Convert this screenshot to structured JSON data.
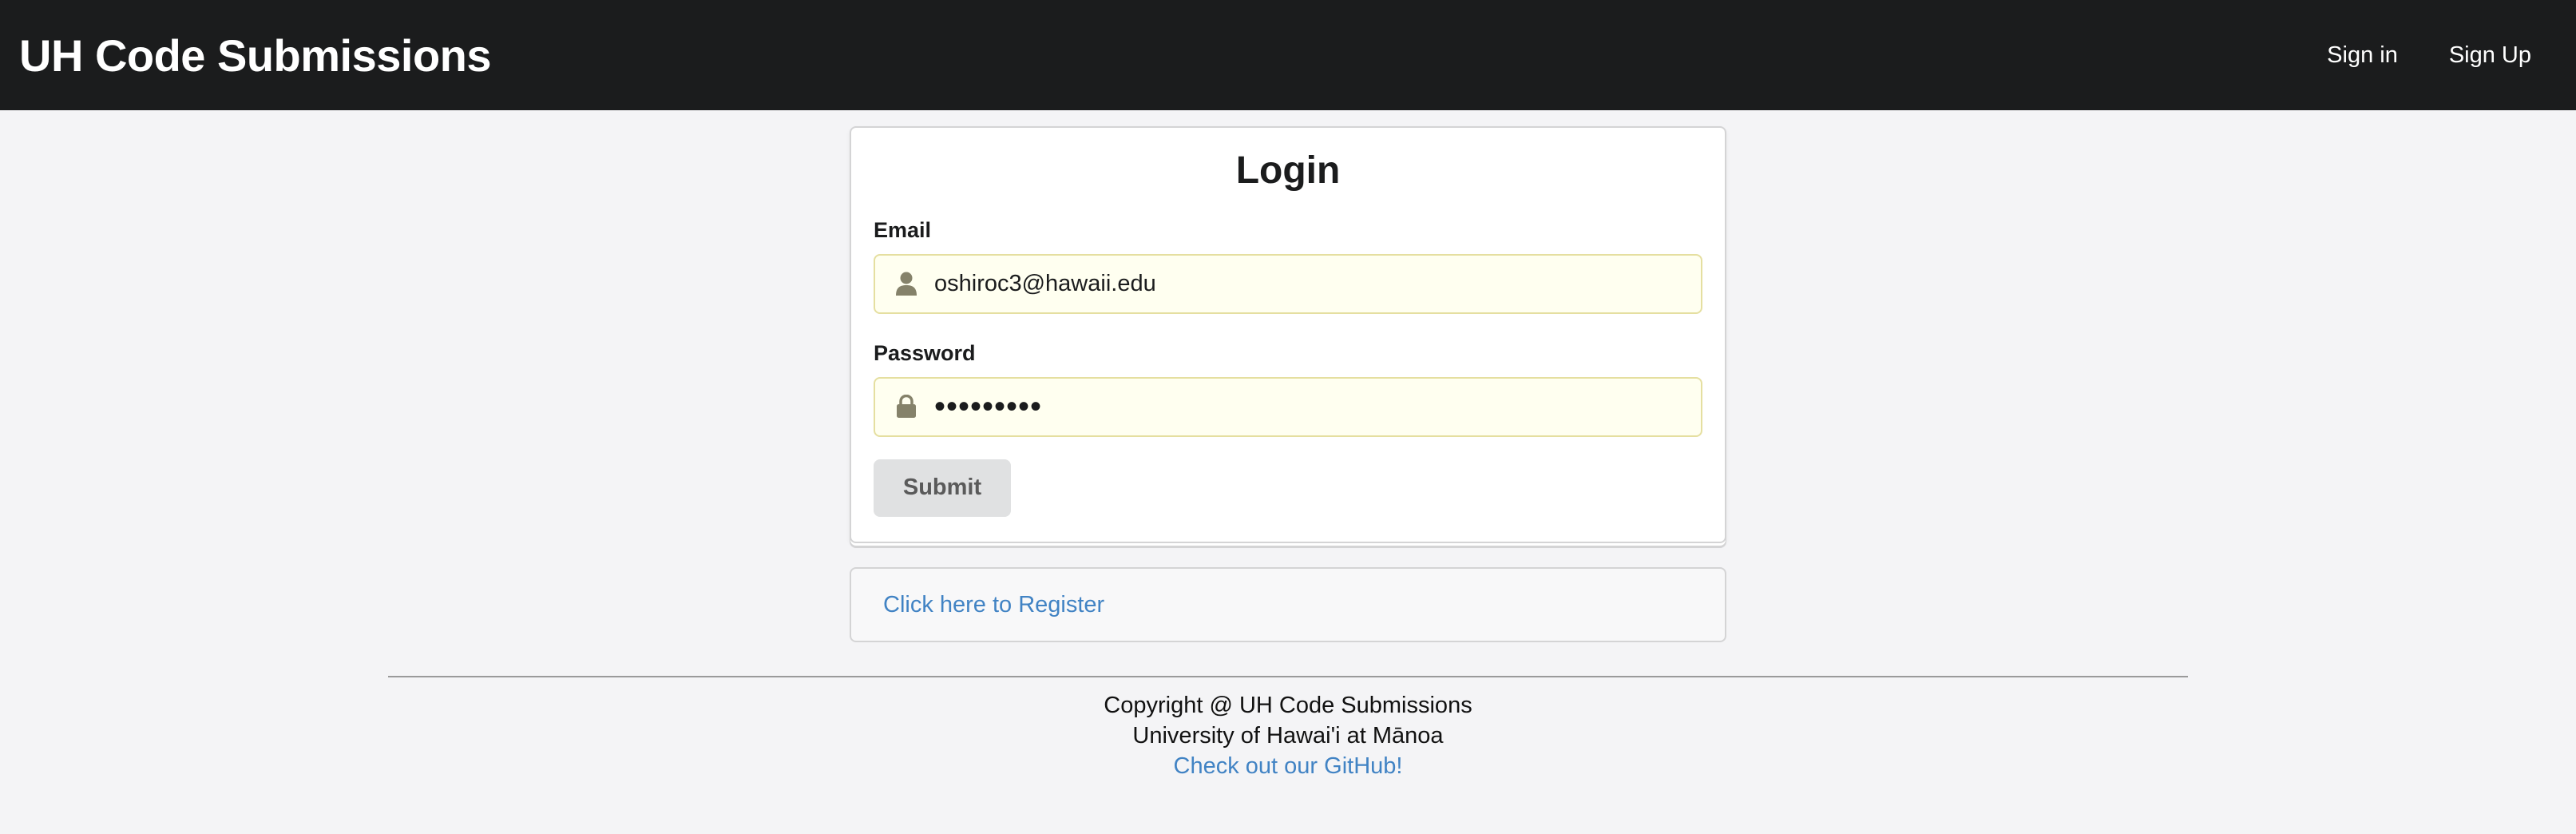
{
  "navbar": {
    "brand": "UH Code Submissions",
    "links": [
      {
        "label": "Sign in"
      },
      {
        "label": "Sign Up"
      }
    ]
  },
  "login": {
    "title": "Login",
    "email": {
      "label": "Email",
      "value": "oshiroc3@hawaii.edu",
      "icon": "user-icon"
    },
    "password": {
      "label": "Password",
      "value": "•••••••••",
      "icon": "lock-icon"
    },
    "submit_label": "Submit"
  },
  "register": {
    "link_text": "Click here to Register"
  },
  "footer": {
    "copyright": "Copyright @ UH Code Submissions",
    "university": "University of Hawai'i at Mānoa",
    "github_link": "Check out our GitHub!"
  },
  "colors": {
    "navbar_bg": "#1b1c1d",
    "page_bg": "#f4f4f6",
    "link": "#4183c4",
    "input_bg": "#fffff0",
    "input_border": "#e5dfa0",
    "button_bg": "#e0e1e2"
  }
}
